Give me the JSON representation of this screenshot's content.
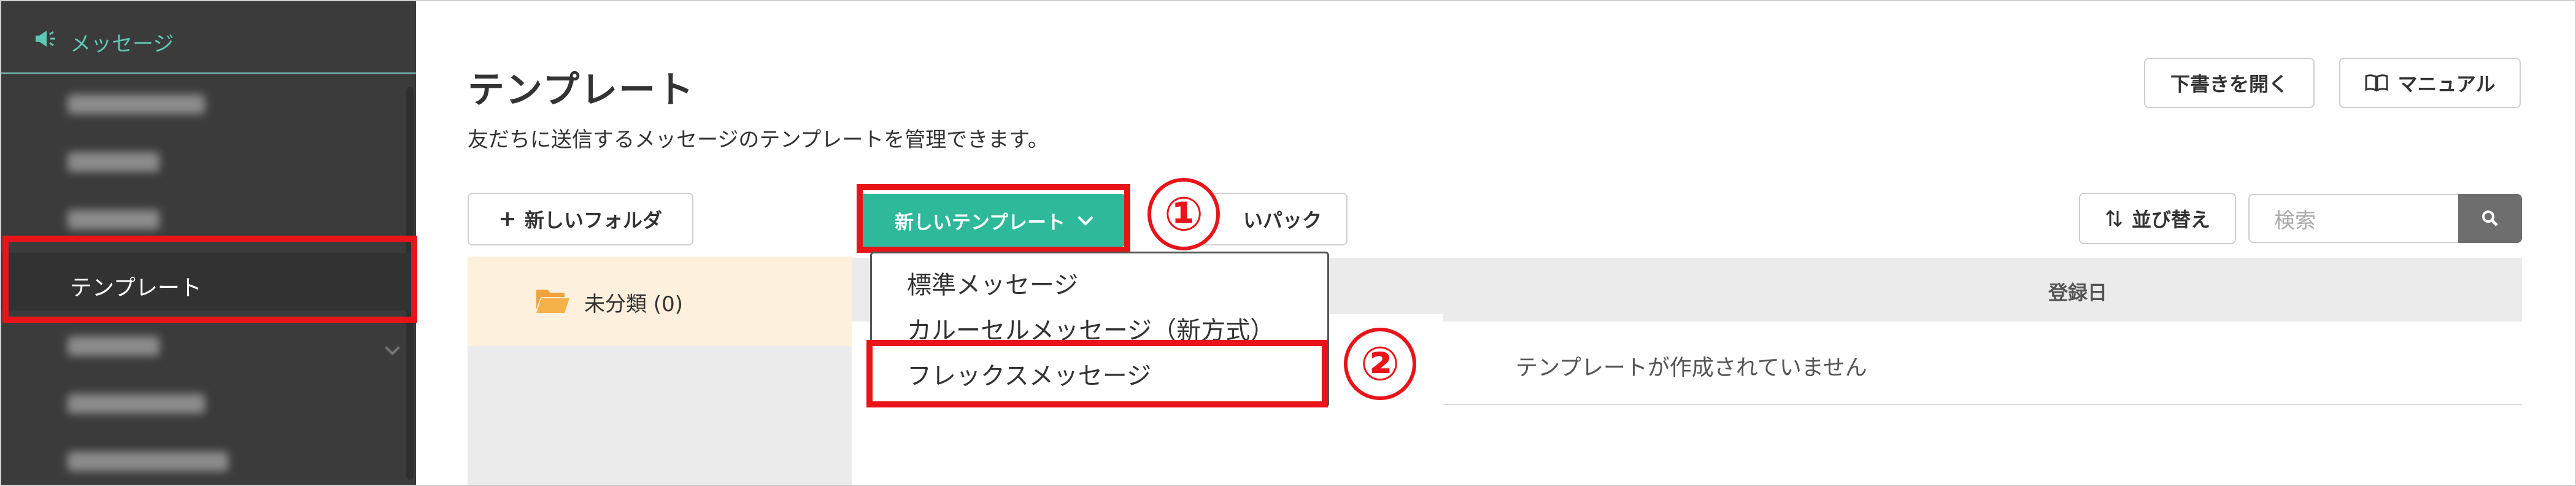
{
  "sidebar": {
    "section_label": "メッセージ",
    "active_item": "テンプレート"
  },
  "header": {
    "title": "テンプレート",
    "subtitle": "友だちに送信するメッセージのテンプレートを管理できます。",
    "draft_button": "下書きを開く",
    "manual_button": "マニュアル"
  },
  "toolbar": {
    "new_folder": "新しいフォルダ",
    "new_template": "新しいテンプレート",
    "pack_button_partial": "いパック",
    "sort": "並び替え",
    "search_placeholder": "検索"
  },
  "folders": [
    {
      "label": "未分類 (0)"
    }
  ],
  "table": {
    "column_date": "登録日",
    "empty_message": "テンプレートが作成されていません"
  },
  "dropdown": {
    "items": [
      "標準メッセージ",
      "カルーセルメッセージ（新方式）",
      "フレックスメッセージ"
    ]
  },
  "annotations": {
    "step1": "①",
    "step2": "②",
    "highlight_color": "#e8141a"
  },
  "colors": {
    "accent": "#2eb99a",
    "sidebar_bg": "#3b3b3b",
    "folder_active_bg": "#fdf0dc"
  }
}
